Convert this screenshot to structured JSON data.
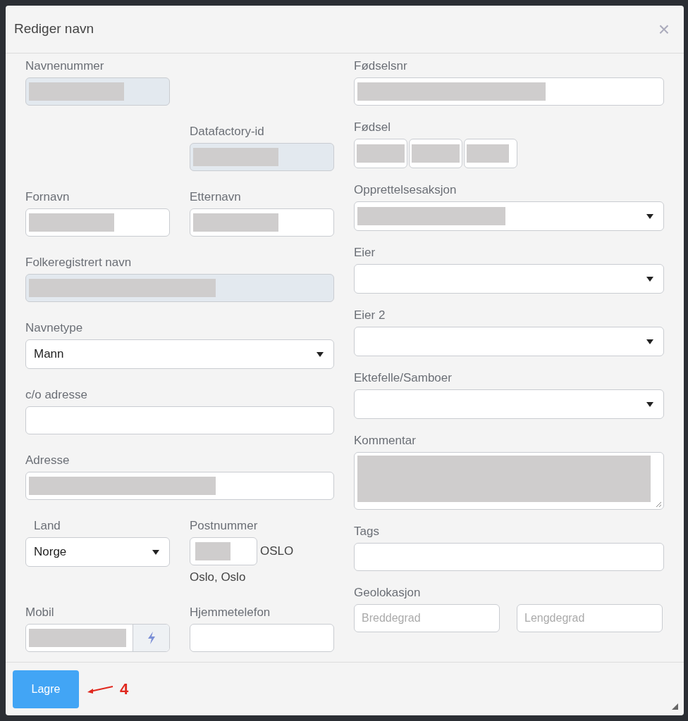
{
  "dialog": {
    "title": "Rediger navn",
    "close": "×"
  },
  "left": [
    {
      "label": "Navnenummer",
      "kind": "text",
      "readonly": true,
      "redacted": true
    },
    {
      "label": "Datafactory-id",
      "kind": "text",
      "readonly": true,
      "redacted": true
    },
    {
      "label": "Fornavn",
      "kind": "text",
      "readonly": false,
      "redacted": true
    },
    {
      "label": "Etternavn",
      "kind": "text",
      "readonly": false,
      "redacted": true
    },
    {
      "label": "Folkeregistrert navn",
      "kind": "text",
      "readonly": true,
      "redacted": true
    },
    {
      "label": "Navnetype",
      "kind": "select",
      "value": "Mann"
    },
    {
      "label": "c/o adresse",
      "kind": "text",
      "readonly": false,
      "redacted": false
    },
    {
      "label": "Adresse",
      "kind": "text",
      "readonly": false,
      "redacted": true
    },
    {
      "label": "Land",
      "kind": "select",
      "value": "Norge"
    },
    {
      "label": "Postnummer",
      "kind": "postal",
      "redacted": true,
      "city": "OSLO",
      "area": "Oslo, Oslo"
    },
    {
      "label": "Mobil",
      "kind": "phone",
      "redacted": true
    },
    {
      "label": "Hjemmetelefon",
      "kind": "text",
      "readonly": false,
      "redacted": false
    }
  ],
  "right": [
    {
      "label": "Fødselsnr",
      "kind": "text",
      "readonly": false,
      "redacted": true
    },
    {
      "label": "Fødsel",
      "kind": "date",
      "redacted": true
    },
    {
      "label": "Opprettelsesaksjon",
      "kind": "select",
      "redacted": true
    },
    {
      "label": "Eier",
      "kind": "select"
    },
    {
      "label": "Eier 2",
      "kind": "select"
    },
    {
      "label": "Ektefelle/Samboer",
      "kind": "select"
    },
    {
      "label": "Kommentar",
      "kind": "textarea",
      "redacted": true
    },
    {
      "label": "Tags",
      "kind": "text",
      "readonly": false,
      "redacted": false
    },
    {
      "label": "Geolokasjon",
      "kind": "geo",
      "placeholders": [
        "Breddegrad",
        "Lengdegrad"
      ]
    }
  ],
  "footer": {
    "save": "Lagre",
    "annotation": "4"
  }
}
